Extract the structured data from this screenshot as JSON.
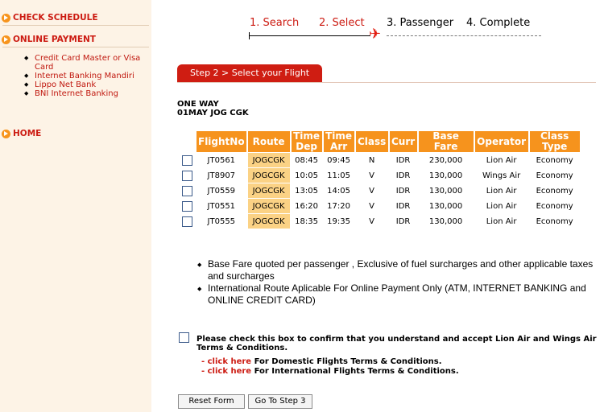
{
  "sidebar": {
    "check_schedule": "CHECK SCHEDULE",
    "online_payment": "ONLINE PAYMENT",
    "payment_methods": [
      "Credit Card Master or Visa Card",
      "Internet Banking Mandiri",
      "Lippo Net Bank",
      "BNI Internet Banking"
    ],
    "home": "HOME"
  },
  "steps": [
    "1. Search",
    "2. Select",
    "3. Passenger",
    "4. Complete"
  ],
  "step_tab": "Step 2 > Select your Flight",
  "trip": {
    "type": "ONE WAY",
    "summary": "01MAY JOG CGK"
  },
  "table": {
    "headers": [
      "FlightNo",
      "Route",
      "Time Dep",
      "Time Arr",
      "Class",
      "Curr",
      "Base Fare",
      "Operator",
      "Class Type"
    ],
    "rows": [
      [
        "JT0561",
        "JOGCGK",
        "08:45",
        "09:45",
        "N",
        "IDR",
        "230,000",
        "Lion Air",
        "Economy"
      ],
      [
        "JT8907",
        "JOGCGK",
        "10:05",
        "11:05",
        "V",
        "IDR",
        "130,000",
        "Wings Air",
        "Economy"
      ],
      [
        "JT0559",
        "JOGCGK",
        "13:05",
        "14:05",
        "V",
        "IDR",
        "130,000",
        "Lion Air",
        "Economy"
      ],
      [
        "JT0551",
        "JOGCGK",
        "16:20",
        "17:20",
        "V",
        "IDR",
        "130,000",
        "Lion Air",
        "Economy"
      ],
      [
        "JT0555",
        "JOGCGK",
        "18:35",
        "19:35",
        "V",
        "IDR",
        "130,000",
        "Lion Air",
        "Economy"
      ]
    ]
  },
  "notes": [
    "Base Fare quoted per passenger , Exclusive of fuel surcharges and other applicable taxes and surcharges",
    "International Route Aplicable For Online Payment Only (ATM, INTERNET BANKING and ONLINE CREDIT CARD)"
  ],
  "confirm_text": "Please check this box to confirm that you understand and accept Lion Air and Wings Air Terms & Conditions.",
  "terms": [
    {
      "link": "- click here",
      "text": " For Domestic Flights Terms & Conditions."
    },
    {
      "link": "- click here",
      "text": " For International Flights Terms & Conditions."
    }
  ],
  "buttons": {
    "reset": "Reset Form",
    "next": "Go To Step 3"
  },
  "colors": {
    "accent_red": "#cc1b12",
    "header_orange": "#f6931d",
    "route_cell": "#fbd285",
    "sidebar_bg": "#fdf3e6"
  }
}
